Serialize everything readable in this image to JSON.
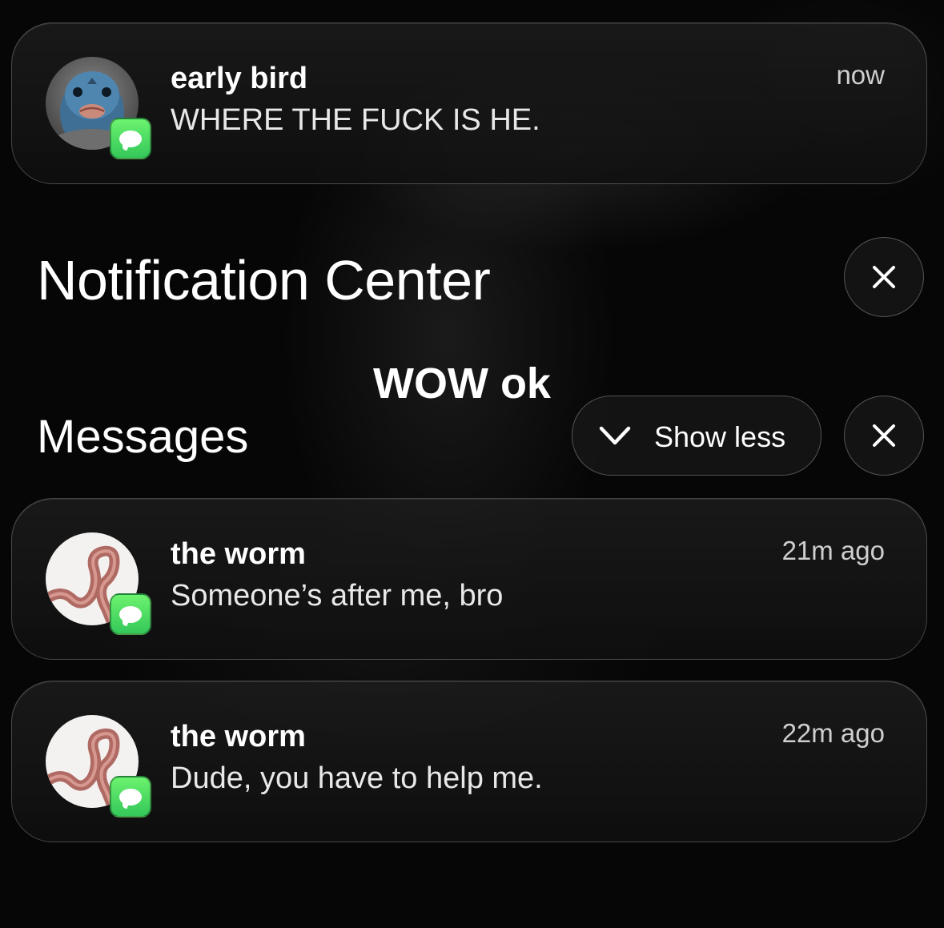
{
  "top_notification": {
    "sender": "early bird",
    "message": "WHERE THE FUCK IS HE.",
    "time": "now",
    "avatar_icon": "pigeon-face-avatar",
    "app_icon": "messages-app-icon"
  },
  "notification_center": {
    "title": "Notification Center",
    "close_icon": "close-icon"
  },
  "overlay_caption": "WOW ok",
  "messages_section": {
    "label": "Messages",
    "show_less_label": "Show less",
    "show_less_icon": "chevron-down-icon",
    "close_icon": "close-icon"
  },
  "notifications": [
    {
      "sender": "the worm",
      "message": "Someone’s after me, bro",
      "time": "21m ago",
      "avatar_icon": "worm-avatar",
      "app_icon": "messages-app-icon"
    },
    {
      "sender": "the worm",
      "message": "Dude, you have to help me.",
      "time": "22m ago",
      "avatar_icon": "worm-avatar",
      "app_icon": "messages-app-icon"
    }
  ],
  "colors": {
    "background": "#060606",
    "messages_green": "#34c759",
    "card": "#1a1a1a",
    "secondary_text": "#cfcfcf"
  }
}
